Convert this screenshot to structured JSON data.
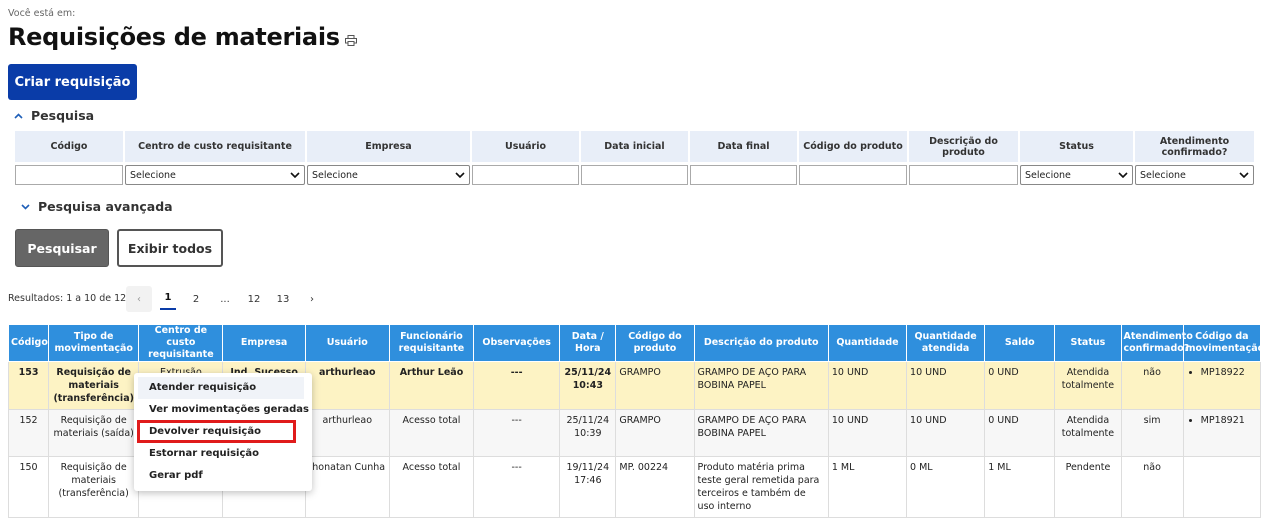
{
  "breadcrumb": "Você está em:",
  "page_title": "Requisições de materiais",
  "create_button": "Criar requisição",
  "search_section": "Pesquisa",
  "advanced_search": "Pesquisa avançada",
  "filters": {
    "codigo": "Código",
    "centro": "Centro de custo requisitante",
    "empresa": "Empresa",
    "usuario": "Usuário",
    "data_inicial": "Data inicial",
    "data_final": "Data final",
    "codigo_produto": "Código do produto",
    "descricao_produto": "Descrição do produto",
    "status": "Status",
    "atendimento": "Atendimento confirmado?",
    "select_placeholder": "Selecione"
  },
  "search_button": "Pesquisar",
  "show_all_button": "Exibir todos",
  "results_text": "Resultados: 1 a 10 de 124.",
  "pagination": {
    "prev": "‹",
    "pages": [
      "1",
      "2",
      "...",
      "12",
      "13"
    ],
    "next": "›",
    "current": "1"
  },
  "table": {
    "headers": [
      "Código",
      "Tipo de movimentação",
      "Centro de custo requisitante",
      "Empresa",
      "Usuário",
      "Funcionário requisitante",
      "Observações",
      "Data / Hora",
      "Código do produto",
      "Descrição do produto",
      "Quantidade",
      "Quantidade atendida",
      "Saldo",
      "Status",
      "Atendimento confirmado?",
      "Código da movimentação"
    ],
    "rows": [
      [
        "153",
        "Requisição de materiais (transferência)",
        "Extrusão",
        "Ind. Sucesso",
        "arthurleao",
        "Arthur Leão",
        "---",
        "25/11/24 10:43",
        "GRAMPO",
        "GRAMPO DE AÇO PARA BOBINA PAPEL",
        "10 UND",
        "10 UND",
        "0 UND",
        "Atendida totalmente",
        "não",
        "MP18922"
      ],
      [
        "152",
        "Requisição de materiais (saída)",
        "",
        "",
        "arthurleao",
        "Acesso total",
        "---",
        "25/11/24 10:39",
        "GRAMPO",
        "GRAMPO DE AÇO PARA BOBINA PAPEL",
        "10 UND",
        "10 UND",
        "0 UND",
        "Atendida totalmente",
        "sim",
        "MP18921"
      ],
      [
        "150",
        "Requisição de materiais (transferência)",
        "",
        "",
        "Jhonatan Cunha",
        "Acesso total",
        "---",
        "19/11/24 17:46",
        "MP. 00224",
        "Produto matéria prima teste geral remetida para terceiros e também de uso interno",
        "1 ML",
        "0 ML",
        "1 ML",
        "Pendente",
        "não",
        ""
      ]
    ]
  },
  "context_menu": [
    "Atender requisição",
    "Ver movimentações geradas",
    "Devolver requisição",
    "Estornar requisição",
    "Gerar pdf"
  ]
}
